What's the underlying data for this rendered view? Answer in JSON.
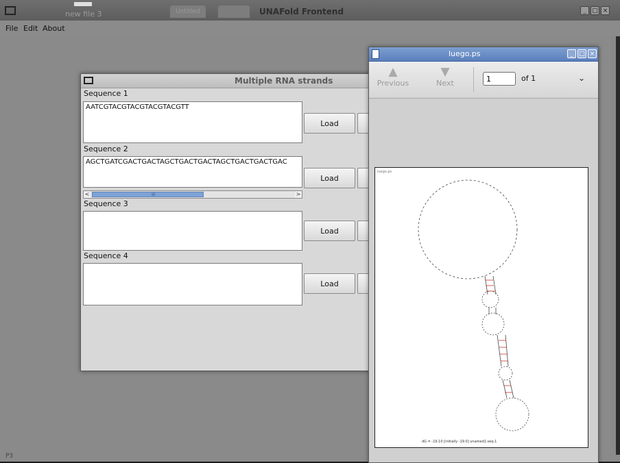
{
  "main_window": {
    "title": "UNAFold Frontend",
    "ghost_tab_1": "Untitled",
    "ghost_file_label": "new file 3",
    "menu": [
      "File",
      "Edit",
      "About"
    ],
    "status_text": "P3"
  },
  "rna_dialog": {
    "title": "Multiple RNA strands",
    "sequences": [
      {
        "label": "Sequence 1",
        "value": "AATCGTACGTACGTACGTACGTT",
        "button": "Load"
      },
      {
        "label": "Sequence 2",
        "value": "AGCTGATCGACTGACTAGCTGACTGACTAGCTGACTGACTGAC",
        "button": "Load"
      },
      {
        "label": "Sequence 3",
        "value": "",
        "button": "Load"
      },
      {
        "label": "Sequence 4",
        "value": "",
        "button": "Load"
      }
    ],
    "scrollbar": {
      "left_arrow": "<",
      "right_arrow": ">",
      "grip": "III"
    }
  },
  "ps_viewer": {
    "title": "luego.ps",
    "prev_label": "Previous",
    "next_label": "Next",
    "page_value": "1",
    "page_of": "of 1",
    "more": "⌄",
    "page_tag": "luego.ps",
    "caption": "dG = -19.10 [initially -19.0] unamed1.seq:1"
  },
  "window_controls": {
    "minimize": "_",
    "maximize": "□",
    "close": "×"
  },
  "colors": {
    "viewer_titlebar": "#5b80bd",
    "scroll_thumb": "#7ea2d6",
    "structure_pair": "#c0392b"
  }
}
